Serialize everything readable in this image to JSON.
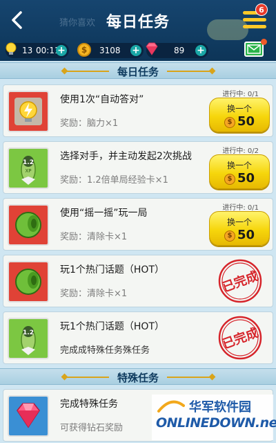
{
  "header": {
    "back_label": "<",
    "title": "每日任务",
    "ghost_text": "猜你喜欢",
    "menu_badge": "6"
  },
  "stats": {
    "energy_count": "13",
    "energy_timer": "00:11",
    "coins": "3108",
    "diamonds": "89",
    "plus": "+"
  },
  "sections": {
    "daily": "每日任务",
    "special": "特殊任务"
  },
  "tasks": [
    {
      "title": "使用1次“自动答对”",
      "reward": "奖励：脑力×1",
      "progress": "进行中: 0/1",
      "button": "换一个",
      "cost": "50",
      "state": "in_progress"
    },
    {
      "title": "选择对手，并主动发起2次挑战",
      "reward": "奖励：1.2倍单局经验卡×1",
      "progress": "进行中: 0/2",
      "button": "换一个",
      "cost": "50",
      "state": "in_progress"
    },
    {
      "title": "使用“摇一摇”玩一局",
      "reward": "奖励：清除卡×1",
      "progress": "进行中: 0/1",
      "button": "换一个",
      "cost": "50",
      "state": "in_progress"
    },
    {
      "title": "玩1个热门话题（HOT）",
      "reward": "奖励：清除卡×1",
      "stamp": "已完成",
      "state": "done"
    },
    {
      "title": "玩1个热门话题（HOT）",
      "reward": "完成成特殊任务殊任务",
      "stamp": "已完成",
      "state": "done"
    }
  ],
  "special_task": {
    "title": "完成特殊任务",
    "reward": "可获得钻石奖励"
  },
  "coin_symbol": "$",
  "watermark": {
    "cn": "华军软件园",
    "en": "ONLINEDOWN.net"
  },
  "colors": {
    "header": "#0d3558",
    "accent_yellow": "#f6d60c",
    "stamp_red": "#d6242a",
    "plus_teal": "#1aa7a6"
  }
}
